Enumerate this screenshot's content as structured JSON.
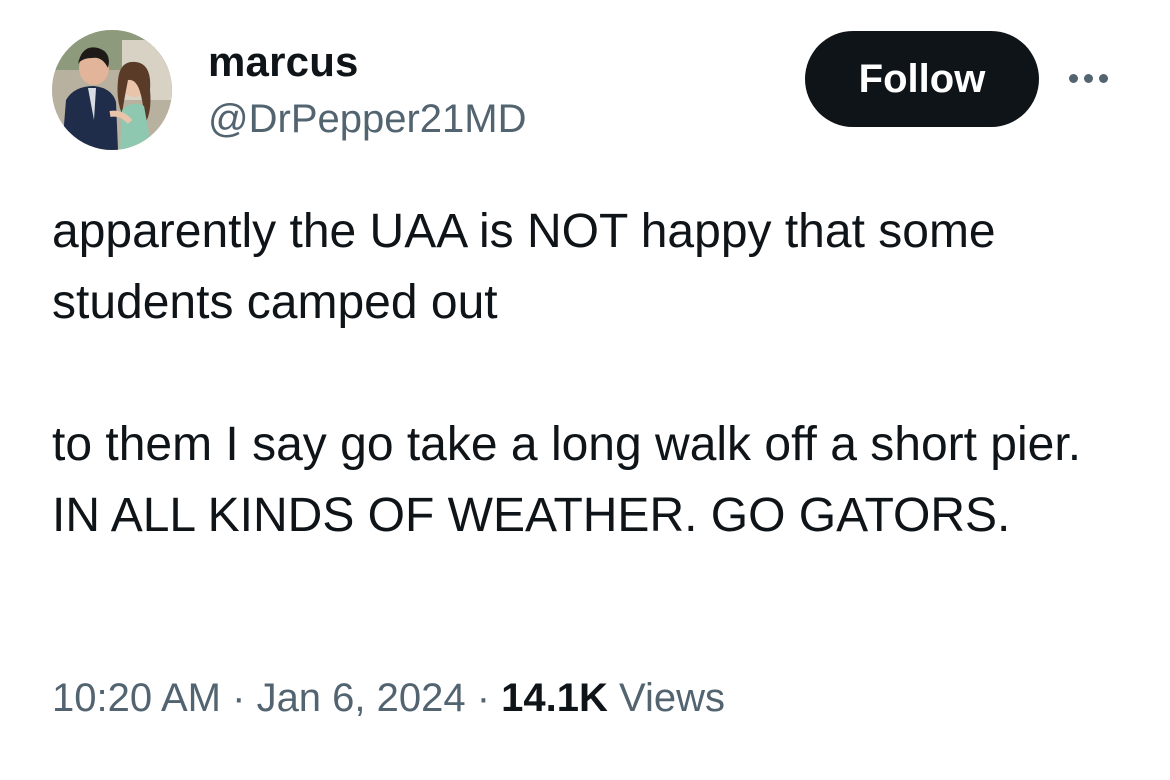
{
  "author": {
    "display_name": "marcus",
    "handle": "@DrPepper21MD",
    "avatar_icon": "profile-photo"
  },
  "actions": {
    "follow_label": "Follow",
    "more_icon": "more-horizontal-icon"
  },
  "tweet": {
    "paragraphs": [
      "apparently the UAA is NOT happy that some students camped out",
      "to them I say go take a long walk off a short pier. IN ALL KINDS OF WEATHER. GO GATORS."
    ]
  },
  "meta": {
    "time": "10:20 AM",
    "separator": " · ",
    "date": "Jan 6, 2024",
    "views_count": "14.1K",
    "views_label": " Views"
  },
  "colors": {
    "text_primary": "#0f1419",
    "text_secondary": "#536471",
    "follow_bg": "#0f1419",
    "background": "#ffffff"
  }
}
